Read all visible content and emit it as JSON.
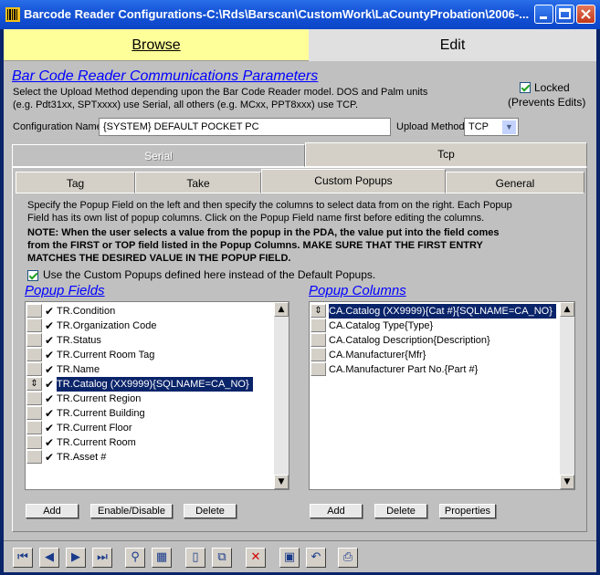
{
  "window": {
    "title": "Barcode Reader Configurations-C:\\Rds\\Barscan\\CustomWork\\LaCountyProbation\\2006-..."
  },
  "top_tabs": {
    "browse": "Browse",
    "edit": "Edit"
  },
  "header": {
    "title": "Bar Code Reader Communications Parameters",
    "desc1": "Select the Upload Method depending upon the Bar Code Reader model. DOS and Palm units",
    "desc2": "(e.g. Pdt31xx, SPTxxxx) use Serial, all others (e.g. MCxx, PPT8xxx) use TCP.",
    "locked_label": "Locked",
    "prevents_label": "(Prevents Edits)",
    "locked_checked": true
  },
  "config": {
    "name_label": "Configuration Name",
    "name_value": "{SYSTEM} DEFAULT POCKET PC",
    "upload_label": "Upload Method",
    "upload_value": "TCP"
  },
  "tabs_l1": {
    "serial": "Serial",
    "tcp": "Tcp"
  },
  "tabs_l2": {
    "tag": "Tag",
    "take": "Take",
    "custom": "Custom Popups",
    "general": "General"
  },
  "instructions": {
    "line1": "Specify the Popup Field on the left and then specify the columns to select data from on the right. Each Popup",
    "line2": "Field has its own list of popup columns. Click on the Popup Field name first before editing the columns.",
    "note1": "NOTE: When the user selects a value from the popup in the PDA, the value put into the field comes",
    "note2": "from the FIRST or TOP field listed in the Popup Columns. MAKE SURE THAT THE FIRST ENTRY",
    "note3": "MATCHES THE DESIRED VALUE IN THE POPUP FIELD.",
    "use_custom": "Use the Custom Popups defined here instead of the Default Popups.",
    "use_custom_checked": true
  },
  "popup_fields": {
    "title": "Popup Fields",
    "items": [
      {
        "label": "TR.Condition"
      },
      {
        "label": "TR.Organization Code"
      },
      {
        "label": "TR.Status"
      },
      {
        "label": "TR.Current Room Tag"
      },
      {
        "label": "TR.Name"
      },
      {
        "label": "TR.Catalog (XX9999){SQLNAME=CA_NO}"
      },
      {
        "label": "TR.Current Region"
      },
      {
        "label": "TR.Current Building"
      },
      {
        "label": "TR.Current Floor"
      },
      {
        "label": "TR.Current Room"
      },
      {
        "label": "TR.Asset #"
      }
    ],
    "selected_index": 5,
    "buttons": {
      "add": "Add",
      "enable": "Enable/Disable",
      "delete": "Delete"
    }
  },
  "popup_columns": {
    "title": "Popup Columns",
    "items": [
      {
        "label": "CA.Catalog (XX9999){Cat #}{SQLNAME=CA_NO}"
      },
      {
        "label": "CA.Catalog Type{Type}"
      },
      {
        "label": "CA.Catalog Description{Description}"
      },
      {
        "label": "CA.Manufacturer{Mfr}"
      },
      {
        "label": "CA.Manufacturer Part No.{Part #}"
      }
    ],
    "selected_index": 0,
    "buttons": {
      "add": "Add",
      "delete": "Delete",
      "properties": "Properties"
    }
  },
  "navbar": {
    "icons": [
      "first-record-icon",
      "prev-record-icon",
      "next-record-icon",
      "last-record-icon",
      "find-icon",
      "filter-icon",
      "new-record-icon",
      "copy-record-icon",
      "delete-record-icon",
      "save-icon",
      "undo-icon",
      "print-preview-icon"
    ]
  }
}
